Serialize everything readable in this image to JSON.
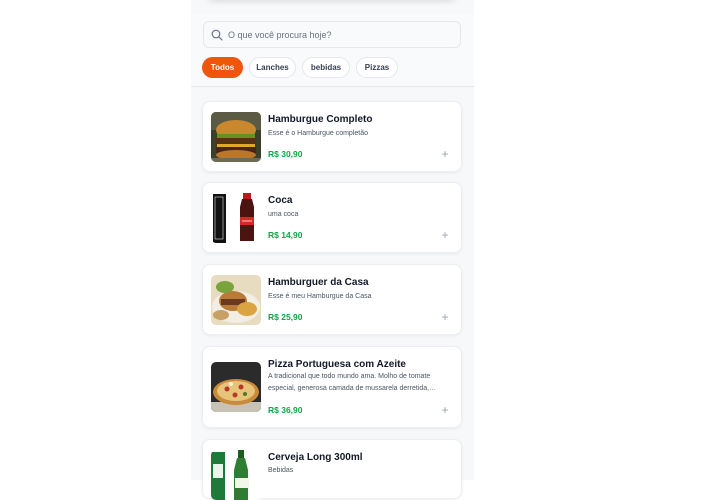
{
  "search": {
    "placeholder": "O que você procura hoje?",
    "value": ""
  },
  "categories": [
    {
      "label": "Todos",
      "active": true
    },
    {
      "label": "Lanches",
      "active": false
    },
    {
      "label": "bebidas",
      "active": false
    },
    {
      "label": "Pizzas",
      "active": false
    }
  ],
  "products": [
    {
      "name": "Hamburgue Completo",
      "description": "Esse é o Hamburgue completão",
      "price": "R$ 30,90",
      "image": "burger-photo"
    },
    {
      "name": "Coca",
      "description": "uma coca",
      "price": "R$ 14,90",
      "image": "coca-bottle-photo"
    },
    {
      "name": "Hamburguer da Casa",
      "description": "Esse é meu Hamburgue da Casa",
      "price": "R$ 25,90",
      "image": "burger-plate-photo"
    },
    {
      "name": "Pizza Portuguesa com Azeite",
      "description": "A tradicional que todo mundo ama. Molho de tomate especial, generosa camada de mussarela derretida, presunto, ovos e cebola.",
      "price": "R$ 36,90",
      "image": "pizza-photo"
    },
    {
      "name": "Cerveja Long 300ml",
      "description": "Bebidas",
      "price": "",
      "image": "beer-bottle-photo"
    }
  ],
  "colors": {
    "accent": "#f0550c",
    "price": "#16a34a"
  }
}
